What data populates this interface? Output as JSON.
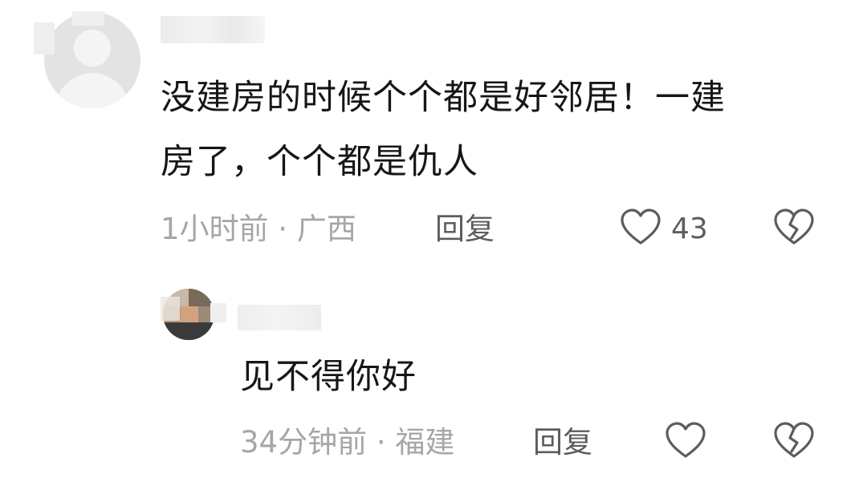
{
  "main_comment": {
    "text_line1": "没建房的时候个个都是好邻居！一建",
    "text_line2": "房了，个个都是仇人",
    "time_location": "1小时前 · 广西",
    "reply_label": "回复",
    "like_count": "43",
    "like_icon": "heart-outline-icon",
    "dislike_icon": "broken-heart-icon"
  },
  "reply_comment": {
    "text": "见不得你好",
    "time_location": "34分钟前 · 福建",
    "reply_label": "回复",
    "like_icon": "heart-outline-icon",
    "dislike_icon": "broken-heart-icon"
  },
  "colors": {
    "text": "#161616",
    "meta": "#a6a6a6",
    "action": "#5c5c5c",
    "avatar_bg": "#e3e3e3"
  }
}
